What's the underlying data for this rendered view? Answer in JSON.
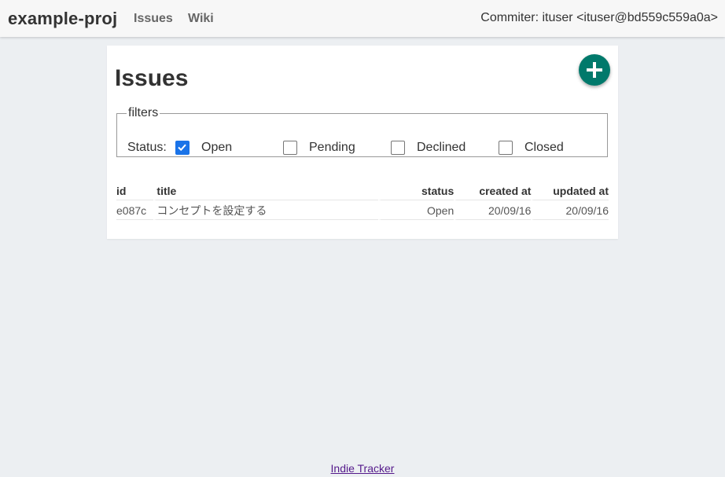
{
  "header": {
    "project_name": "example-proj",
    "nav": [
      {
        "label": "Issues"
      },
      {
        "label": "Wiki"
      }
    ],
    "committer": "Commiter: ituser <ituser@bd559c559a0a>"
  },
  "main": {
    "title": "Issues",
    "add_icon": "plus-icon",
    "accent_color": "#00796b",
    "filters": {
      "legend": "filters",
      "status_label": "Status:",
      "options": [
        {
          "label": "Open",
          "checked": true
        },
        {
          "label": "Pending",
          "checked": false
        },
        {
          "label": "Declined",
          "checked": false
        },
        {
          "label": "Closed",
          "checked": false
        }
      ]
    },
    "table": {
      "columns": [
        "id",
        "title",
        "status",
        "created at",
        "updated at"
      ],
      "rows": [
        {
          "id": "e087c",
          "title": "コンセプトを設定する",
          "status": "Open",
          "created_at": "20/09/16",
          "updated_at": "20/09/16"
        }
      ]
    }
  },
  "footer": {
    "link_text": "Indie Tracker"
  }
}
